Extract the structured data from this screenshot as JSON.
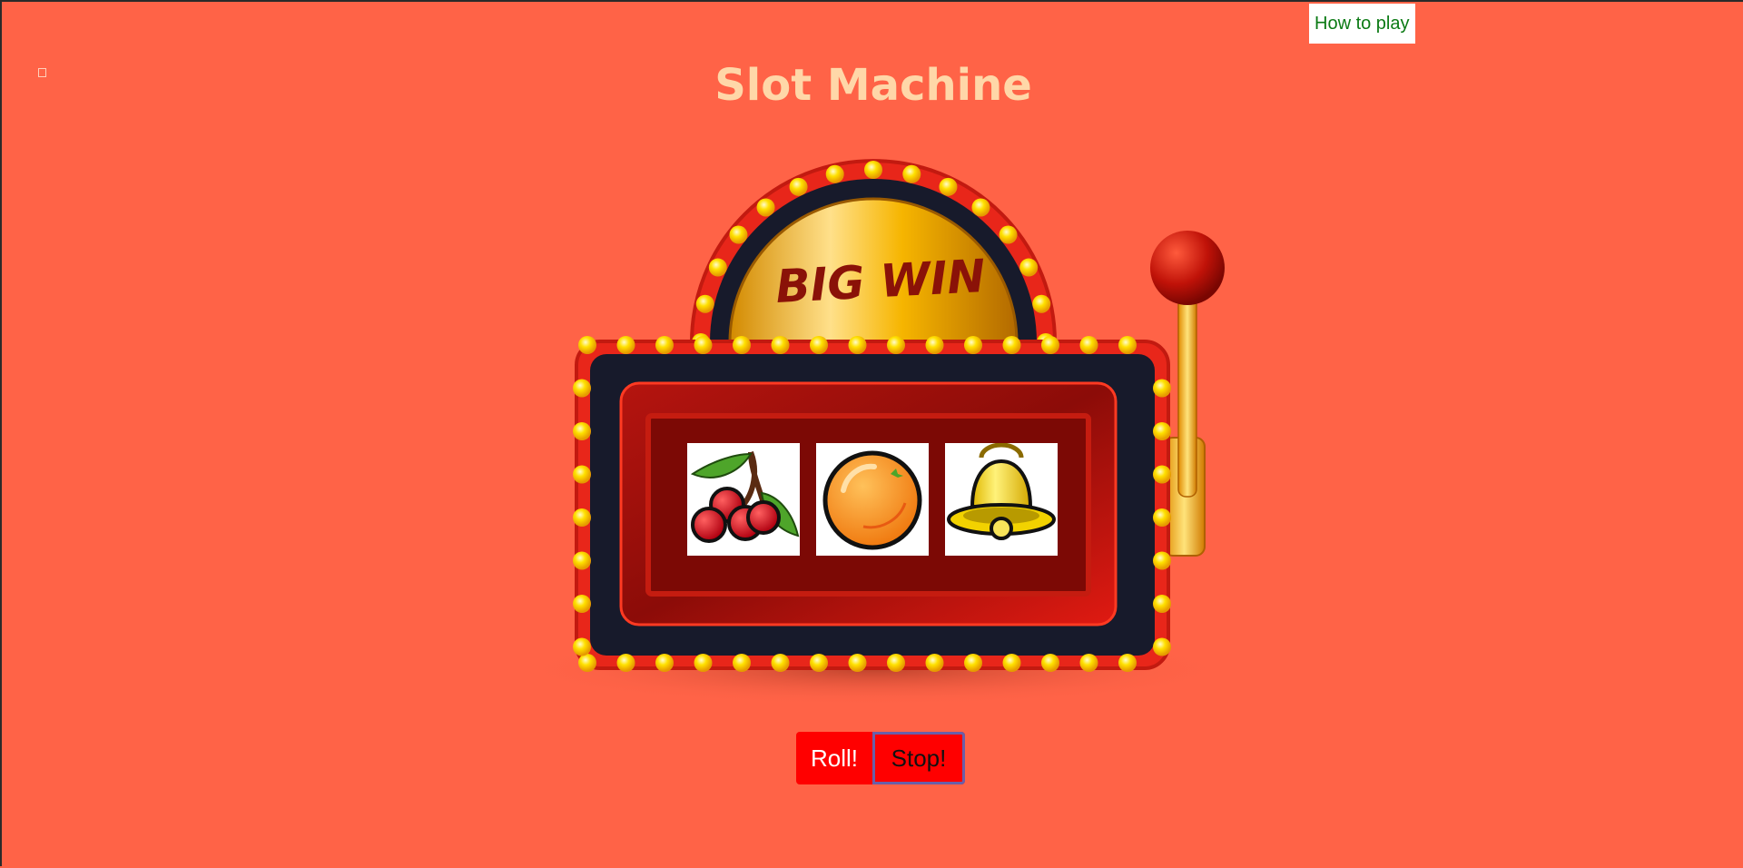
{
  "header": {
    "title": "Slot Machine",
    "how_to_play_label": "How to play"
  },
  "machine": {
    "banner_text": "BIG WIN",
    "reels": [
      {
        "symbol": "cherries"
      },
      {
        "symbol": "orange"
      },
      {
        "symbol": "bell"
      }
    ]
  },
  "controls": {
    "roll_label": "Roll!",
    "stop_label": "Stop!"
  },
  "colors": {
    "background": "#ff6347",
    "title": "#ffd7a8",
    "button": "#ff0000",
    "link": "#0b7a14"
  }
}
